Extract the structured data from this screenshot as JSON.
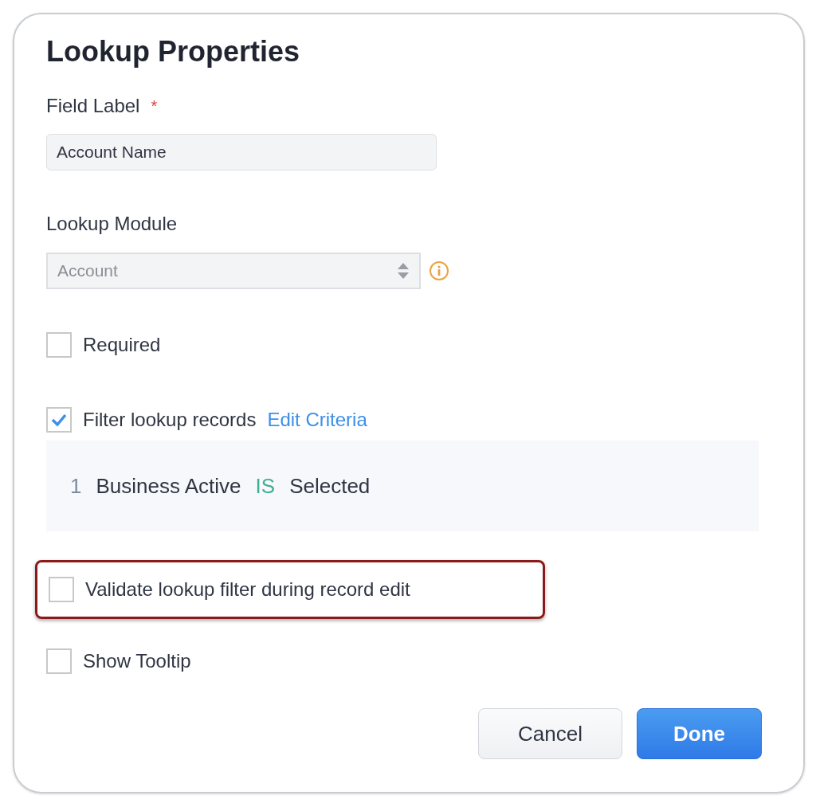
{
  "title": "Lookup Properties",
  "field_label": {
    "label": "Field Label",
    "required_mark": "*",
    "value": "Account Name"
  },
  "lookup_module": {
    "label": "Lookup Module",
    "value": "Account",
    "disabled": true
  },
  "options": [
    {
      "label": "Required",
      "checked": false,
      "highlighted": false
    },
    {
      "label": "Filter lookup records",
      "checked": true,
      "highlighted": false,
      "link": "Edit Criteria",
      "criteria": [
        {
          "index": "1",
          "field": "Business Active",
          "operator": "IS",
          "value": "Selected"
        }
      ]
    },
    {
      "label": "Validate lookup filter during record edit",
      "checked": false,
      "highlighted": true
    },
    {
      "label": "Show Tooltip",
      "checked": false,
      "highlighted": false
    }
  ],
  "buttons": [
    {
      "label": "Cancel",
      "kind": "secondary"
    },
    {
      "label": "Done",
      "kind": "primary"
    }
  ]
}
